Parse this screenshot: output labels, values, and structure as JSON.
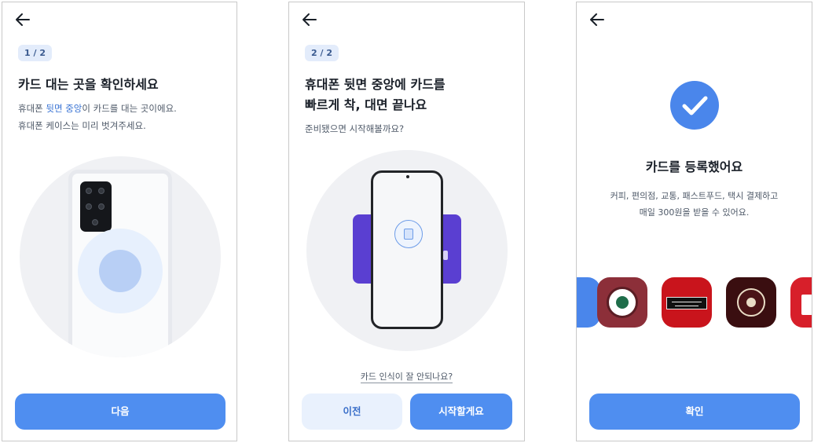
{
  "screen1": {
    "step": "1 / 2",
    "title": "카드 대는 곳을 확인하세요",
    "desc_line1_pre": "휴대폰 ",
    "desc_line1_hl": "뒷면 중앙",
    "desc_line1_post": "이 카드를 대는 곳이에요.",
    "desc_line2": "휴대폰 케이스는 미리 벗겨주세요.",
    "next_button": "다음",
    "accent_color": "#3a74d4"
  },
  "screen2": {
    "step": "2 / 2",
    "title_line1": "휴대폰 뒷면 중앙에 카드를",
    "title_line2": "빠르게 착, 대면 끝나요",
    "desc": "준비됐으면 시작해볼까요?",
    "help_link": "카드 인식이 잘 안되나요?",
    "prev_button": "이전",
    "start_button": "시작할게요",
    "card_color": "#5a3fd1"
  },
  "screen3": {
    "title": "카드를 등록했어요",
    "desc_line1": "커피, 편의점, 교통, 패스트푸드, 택시 결제하고",
    "desc_line2": "매일 300원을 받을 수 있어요.",
    "confirm_button": "확인",
    "check_color": "#4a86eb"
  },
  "button_color": "#4f8ef0"
}
